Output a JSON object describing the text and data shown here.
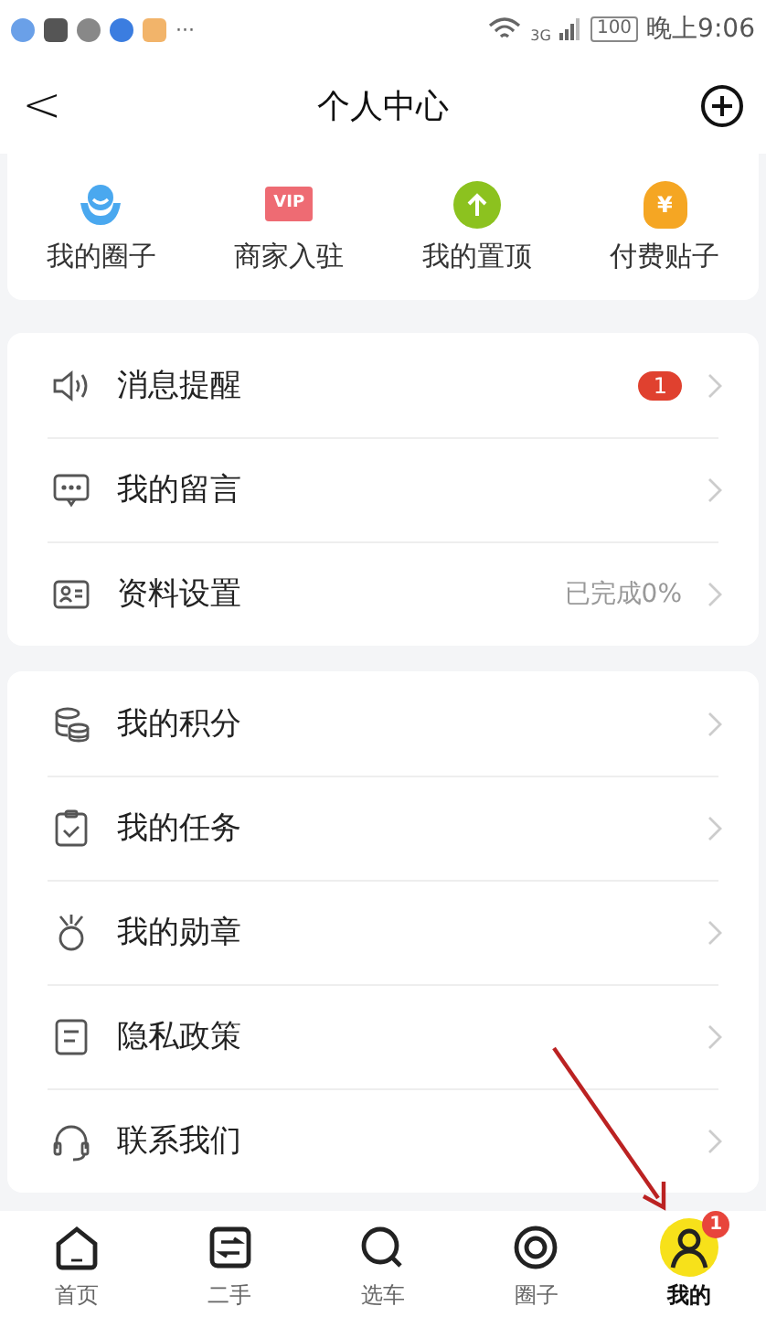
{
  "status_bar": {
    "more": "···",
    "network": "3G",
    "battery": "100",
    "time": "晚上9:06"
  },
  "header": {
    "back": "<",
    "title": "个人中心"
  },
  "shortcuts": [
    {
      "label": "我的圈子"
    },
    {
      "label": "商家入驻",
      "icon_text": "VIP"
    },
    {
      "label": "我的置顶"
    },
    {
      "label": "付费贴子",
      "icon_text": "¥"
    }
  ],
  "menu_groups": [
    [
      {
        "label": "消息提醒",
        "badge": "1"
      },
      {
        "label": "我的留言"
      },
      {
        "label": "资料设置",
        "value": "已完成0%"
      }
    ],
    [
      {
        "label": "我的积分"
      },
      {
        "label": "我的任务"
      },
      {
        "label": "我的勋章"
      },
      {
        "label": "隐私政策"
      },
      {
        "label": "联系我们"
      }
    ]
  ],
  "tab_bar": [
    {
      "label": "首页",
      "selected": false
    },
    {
      "label": "二手",
      "selected": false
    },
    {
      "label": "选车",
      "selected": false
    },
    {
      "label": "圈子",
      "selected": false
    },
    {
      "label": "我的",
      "selected": true,
      "badge": "1"
    }
  ]
}
